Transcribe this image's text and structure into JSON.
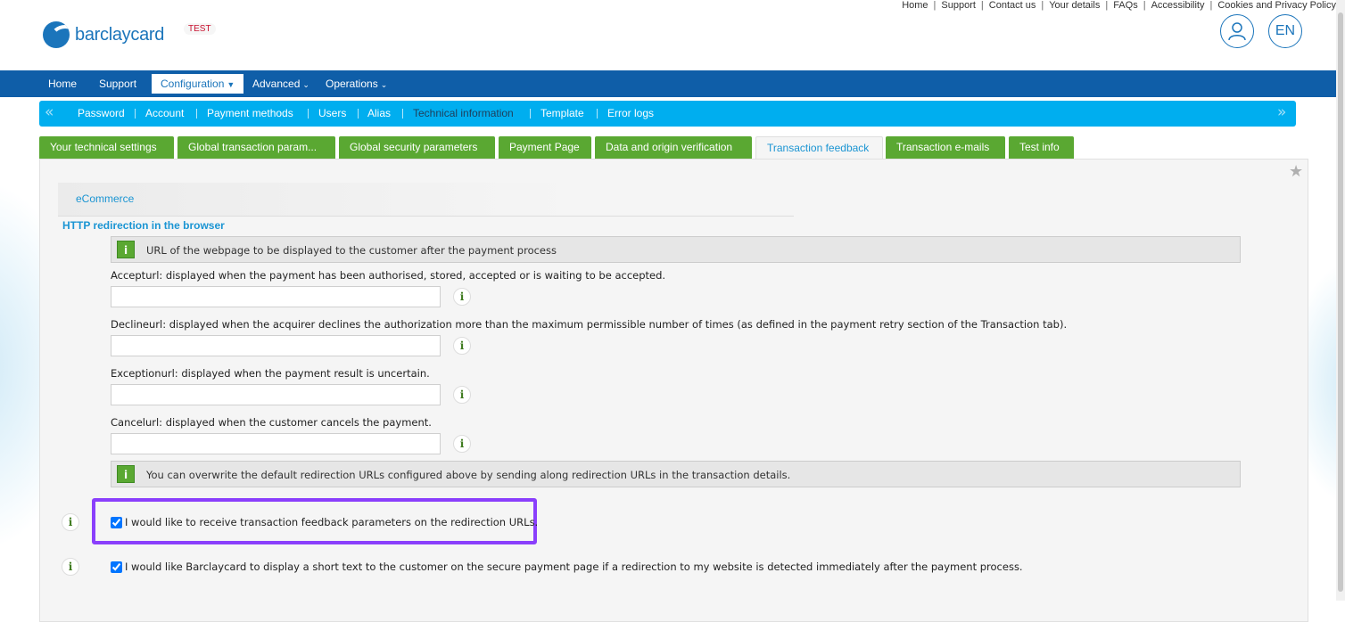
{
  "header": {
    "top_links": [
      "Home",
      "Support",
      "Contact us",
      "Your details",
      "FAQs",
      "Accessibility",
      "Cookies and Privacy Policy"
    ],
    "logo_text": "barclaycard",
    "env_badge": "TEST",
    "lang": "EN"
  },
  "main_nav": [
    {
      "label": "Home"
    },
    {
      "label": "Support"
    },
    {
      "label": "Configuration",
      "active": true
    },
    {
      "label": "Advanced"
    },
    {
      "label": "Operations"
    }
  ],
  "sub_nav": [
    "Password",
    "Account",
    "Payment methods",
    "Users",
    "Alias",
    "Technical information",
    "Template",
    "Error logs"
  ],
  "sub_nav_active": "Technical information",
  "tabs": [
    "Your technical settings",
    "Global transaction param...",
    "Global security parameters",
    "Payment Page",
    "Data and origin verification",
    "Transaction feedback",
    "Transaction e-mails",
    "Test info"
  ],
  "active_tab": "Transaction feedback",
  "content": {
    "section_bar": "eCommerce",
    "section_title": "HTTP redirection in the browser",
    "info_top": "URL of the webpage to be displayed to the customer after the payment process",
    "accept_label": "Accepturl: displayed when the payment has been authorised, stored, accepted or is waiting to be accepted.",
    "accept_value": "",
    "decline_label": "Declineurl: displayed when the acquirer declines the authorization more than the maximum permissible number of times (as defined in the payment retry section of the Transaction tab).",
    "decline_value": "",
    "exception_label": "Exceptionurl: displayed when the payment result is uncertain.",
    "exception_value": "",
    "cancel_label": "Cancelurl: displayed when the customer cancels the payment.",
    "cancel_value": "",
    "info_bottom": "You can overwrite the default redirection URLs configured above by sending along redirection URLs in the transaction details.",
    "checkbox_feedback_label": "I would like to receive transaction feedback parameters on the redirection URLs.",
    "checkbox_feedback_checked": true,
    "checkbox_redirect_label": "I would like Barclaycard to display a short text to the customer on the secure payment page if a redirection to my website is detected immediately after the payment process.",
    "checkbox_redirect_checked": true,
    "info_glyph": "i"
  },
  "colors": {
    "brand_blue": "#1b75bb",
    "nav_blue": "#0f5ea8",
    "subnav_cyan": "#00aeef",
    "tab_green": "#5aa832",
    "highlight_purple": "#8a3ffc"
  }
}
